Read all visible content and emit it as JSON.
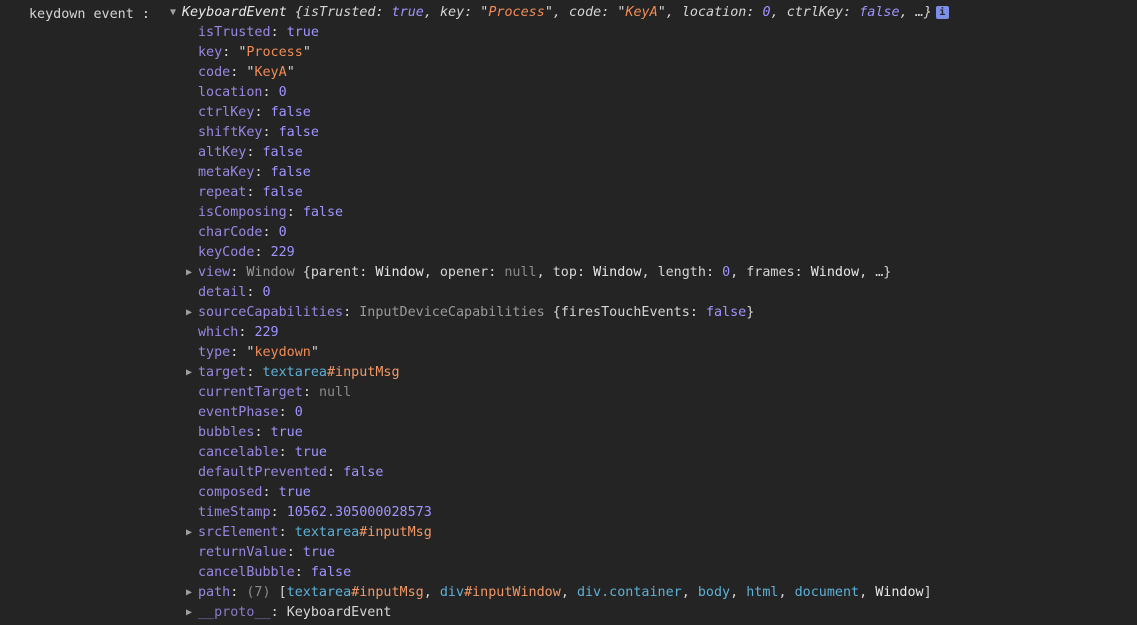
{
  "log": {
    "label": "keydown event :"
  },
  "summary": {
    "type": "KeyboardEvent",
    "text_open": " {",
    "k1": "isTrusted",
    "v1": "true",
    "k2": "key",
    "v2": "Process",
    "k3": "code",
    "v3": "KeyA",
    "k4": "location",
    "v4": "0",
    "k5": "ctrlKey",
    "v5": "false",
    "tail": ", …}",
    "info": "i"
  },
  "props": [
    {
      "key": "isTrusted",
      "value": "true",
      "kind": "bool"
    },
    {
      "key": "key",
      "value": "Process",
      "kind": "str"
    },
    {
      "key": "code",
      "value": "KeyA",
      "kind": "str"
    },
    {
      "key": "location",
      "value": "0",
      "kind": "num"
    },
    {
      "key": "ctrlKey",
      "value": "false",
      "kind": "bool"
    },
    {
      "key": "shiftKey",
      "value": "false",
      "kind": "bool"
    },
    {
      "key": "altKey",
      "value": "false",
      "kind": "bool"
    },
    {
      "key": "metaKey",
      "value": "false",
      "kind": "bool"
    },
    {
      "key": "repeat",
      "value": "false",
      "kind": "bool"
    },
    {
      "key": "isComposing",
      "value": "false",
      "kind": "bool"
    },
    {
      "key": "charCode",
      "value": "0",
      "kind": "num"
    },
    {
      "key": "keyCode",
      "value": "229",
      "kind": "num"
    },
    {
      "key": "view",
      "kind": "obj",
      "expandable": true,
      "parts": [
        {
          "t": "Window",
          "c": "cls"
        },
        {
          "t": " {",
          "c": "q"
        },
        {
          "t": "parent",
          "c": "q"
        },
        {
          "t": ": ",
          "c": "q"
        },
        {
          "t": "Window",
          "c": "bold"
        },
        {
          "t": ", ",
          "c": "q"
        },
        {
          "t": "opener",
          "c": "q"
        },
        {
          "t": ": ",
          "c": "q"
        },
        {
          "t": "null",
          "c": "nul"
        },
        {
          "t": ", ",
          "c": "q"
        },
        {
          "t": "top",
          "c": "q"
        },
        {
          "t": ": ",
          "c": "q"
        },
        {
          "t": "Window",
          "c": "bold"
        },
        {
          "t": ", ",
          "c": "q"
        },
        {
          "t": "length",
          "c": "q"
        },
        {
          "t": ": ",
          "c": "q"
        },
        {
          "t": "0",
          "c": "num"
        },
        {
          "t": ", ",
          "c": "q"
        },
        {
          "t": "frames",
          "c": "q"
        },
        {
          "t": ": ",
          "c": "q"
        },
        {
          "t": "Window",
          "c": "bold"
        },
        {
          "t": ", …}",
          "c": "q"
        }
      ]
    },
    {
      "key": "detail",
      "value": "0",
      "kind": "num"
    },
    {
      "key": "sourceCapabilities",
      "kind": "obj",
      "expandable": true,
      "parts": [
        {
          "t": "InputDeviceCapabilities",
          "c": "cls"
        },
        {
          "t": " {",
          "c": "q"
        },
        {
          "t": "firesTouchEvents",
          "c": "q"
        },
        {
          "t": ": ",
          "c": "q"
        },
        {
          "t": "false",
          "c": "bool"
        },
        {
          "t": "}",
          "c": "q"
        }
      ]
    },
    {
      "key": "which",
      "value": "229",
      "kind": "num"
    },
    {
      "key": "type",
      "value": "keydown",
      "kind": "str"
    },
    {
      "key": "target",
      "kind": "obj",
      "expandable": true,
      "parts": [
        {
          "t": "textarea",
          "c": "tag"
        },
        {
          "t": "#inputMsg",
          "c": "idn"
        }
      ]
    },
    {
      "key": "currentTarget",
      "value": "null",
      "kind": "nul"
    },
    {
      "key": "eventPhase",
      "value": "0",
      "kind": "num"
    },
    {
      "key": "bubbles",
      "value": "true",
      "kind": "bool"
    },
    {
      "key": "cancelable",
      "value": "true",
      "kind": "bool"
    },
    {
      "key": "defaultPrevented",
      "value": "false",
      "kind": "bool"
    },
    {
      "key": "composed",
      "value": "true",
      "kind": "bool"
    },
    {
      "key": "timeStamp",
      "value": "10562.305000028573",
      "kind": "num"
    },
    {
      "key": "srcElement",
      "kind": "obj",
      "expandable": true,
      "parts": [
        {
          "t": "textarea",
          "c": "tag"
        },
        {
          "t": "#inputMsg",
          "c": "idn"
        }
      ]
    },
    {
      "key": "returnValue",
      "value": "true",
      "kind": "bool"
    },
    {
      "key": "cancelBubble",
      "value": "false",
      "kind": "bool"
    },
    {
      "key": "path",
      "kind": "obj",
      "expandable": true,
      "parts": [
        {
          "t": "(7)",
          "c": "dim"
        },
        {
          "t": " [",
          "c": "q"
        },
        {
          "t": "textarea",
          "c": "tag"
        },
        {
          "t": "#inputMsg",
          "c": "idn"
        },
        {
          "t": ", ",
          "c": "q"
        },
        {
          "t": "div",
          "c": "tag"
        },
        {
          "t": "#inputWindow",
          "c": "idn"
        },
        {
          "t": ", ",
          "c": "q"
        },
        {
          "t": "div",
          "c": "tag"
        },
        {
          "t": ".container",
          "c": "tag"
        },
        {
          "t": ", ",
          "c": "q"
        },
        {
          "t": "body",
          "c": "tag"
        },
        {
          "t": ", ",
          "c": "q"
        },
        {
          "t": "html",
          "c": "tag"
        },
        {
          "t": ", ",
          "c": "q"
        },
        {
          "t": "document",
          "c": "tag"
        },
        {
          "t": ", ",
          "c": "q"
        },
        {
          "t": "Window",
          "c": "bold"
        },
        {
          "t": "]",
          "c": "q"
        }
      ]
    },
    {
      "key": "__proto__",
      "kind": "obj",
      "expandable": true,
      "dimKey": true,
      "parts": [
        {
          "t": "KeyboardEvent",
          "c": "q"
        }
      ]
    }
  ],
  "colors": {
    "background": "#242424",
    "key": "#9b87e2",
    "string": "#f28b54",
    "number": "#9f94ff",
    "tag": "#5db0d7",
    "id": "#f29766"
  },
  "icons": {
    "expand": "triangle-right-icon",
    "collapse": "triangle-down-icon",
    "info": "info-icon"
  }
}
